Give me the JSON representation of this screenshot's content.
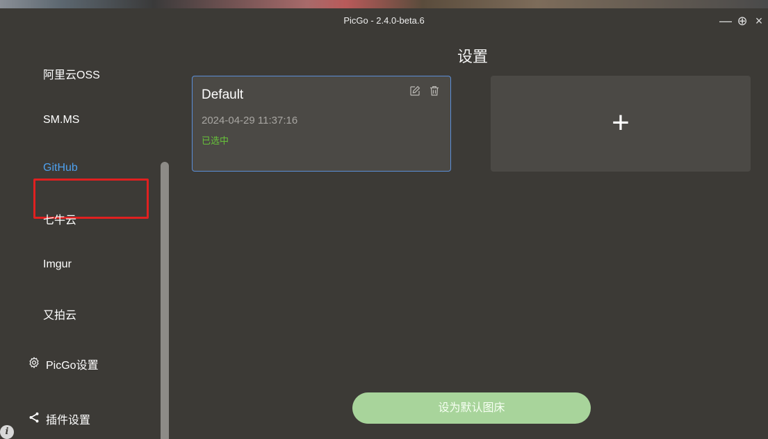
{
  "window": {
    "title": "PicGo - 2.4.0-beta.6",
    "controls": {
      "minimize": "—",
      "pin": "⊕",
      "close": "×"
    }
  },
  "sidebar": {
    "items": [
      {
        "label": "阿里云OSS"
      },
      {
        "label": "SM.MS"
      },
      {
        "label": "GitHub",
        "active": true
      },
      {
        "label": "七牛云"
      },
      {
        "label": "Imgur"
      },
      {
        "label": "又拍云"
      }
    ],
    "picgo_settings": {
      "label": "PicGo设置",
      "icon": "gear-icon"
    },
    "plugin_settings": {
      "label": "插件设置",
      "icon": "share-icon"
    }
  },
  "main": {
    "title": "设置",
    "config_card": {
      "name": "Default",
      "date": "2024-04-29 11:37:16",
      "status": "已选中"
    },
    "add_card": {
      "symbol": "+"
    },
    "default_button": {
      "label": "设为默认图床"
    }
  },
  "colors": {
    "background": "#3c3a36",
    "card": "#4b4945",
    "active_text": "#4ea0ee",
    "selected_status": "#67c23a",
    "card_border": "#5b8fd9",
    "highlight": "#e02020",
    "button": "#a8d49b"
  }
}
